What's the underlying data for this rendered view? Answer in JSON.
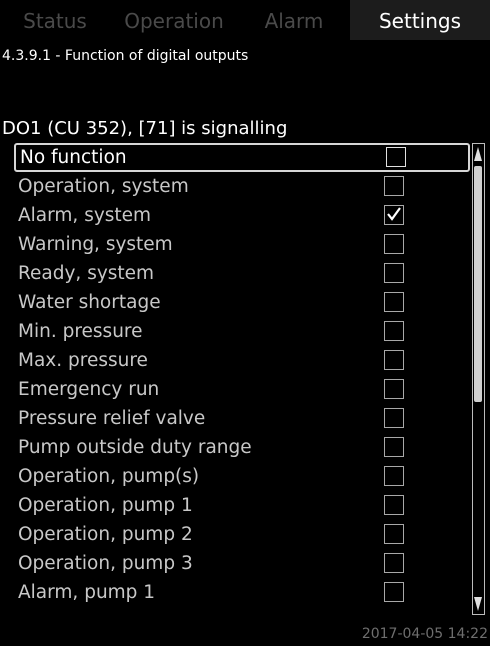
{
  "tabs": [
    {
      "label": "Status",
      "active": false
    },
    {
      "label": "Operation",
      "active": false
    },
    {
      "label": "Alarm",
      "active": false
    },
    {
      "label": "Settings",
      "active": true
    }
  ],
  "breadcrumb": "4.3.9.1 - Function of digital outputs",
  "heading": "DO1 (CU 352), [71] is signalling",
  "items": [
    {
      "label": "No function",
      "checked": false,
      "selected": true
    },
    {
      "label": "Operation, system",
      "checked": false
    },
    {
      "label": "Alarm, system",
      "checked": true
    },
    {
      "label": "Warning, system",
      "checked": false
    },
    {
      "label": "Ready, system",
      "checked": false
    },
    {
      "label": "Water shortage",
      "checked": false
    },
    {
      "label": "Min. pressure",
      "checked": false
    },
    {
      "label": "Max. pressure",
      "checked": false
    },
    {
      "label": "Emergency run",
      "checked": false
    },
    {
      "label": "Pressure relief valve",
      "checked": false
    },
    {
      "label": "Pump outside duty range",
      "checked": false
    },
    {
      "label": "Operation, pump(s)",
      "checked": false
    },
    {
      "label": "Operation, pump 1",
      "checked": false
    },
    {
      "label": "Operation, pump 2",
      "checked": false
    },
    {
      "label": "Operation, pump 3",
      "checked": false
    },
    {
      "label": "Alarm, pump 1",
      "checked": false
    }
  ],
  "timestamp": "2017-04-05 14:22",
  "colors": {
    "background": "#000000",
    "active_tab": "#1c1c1c",
    "inactive_tab_text": "#4a4a4a"
  }
}
